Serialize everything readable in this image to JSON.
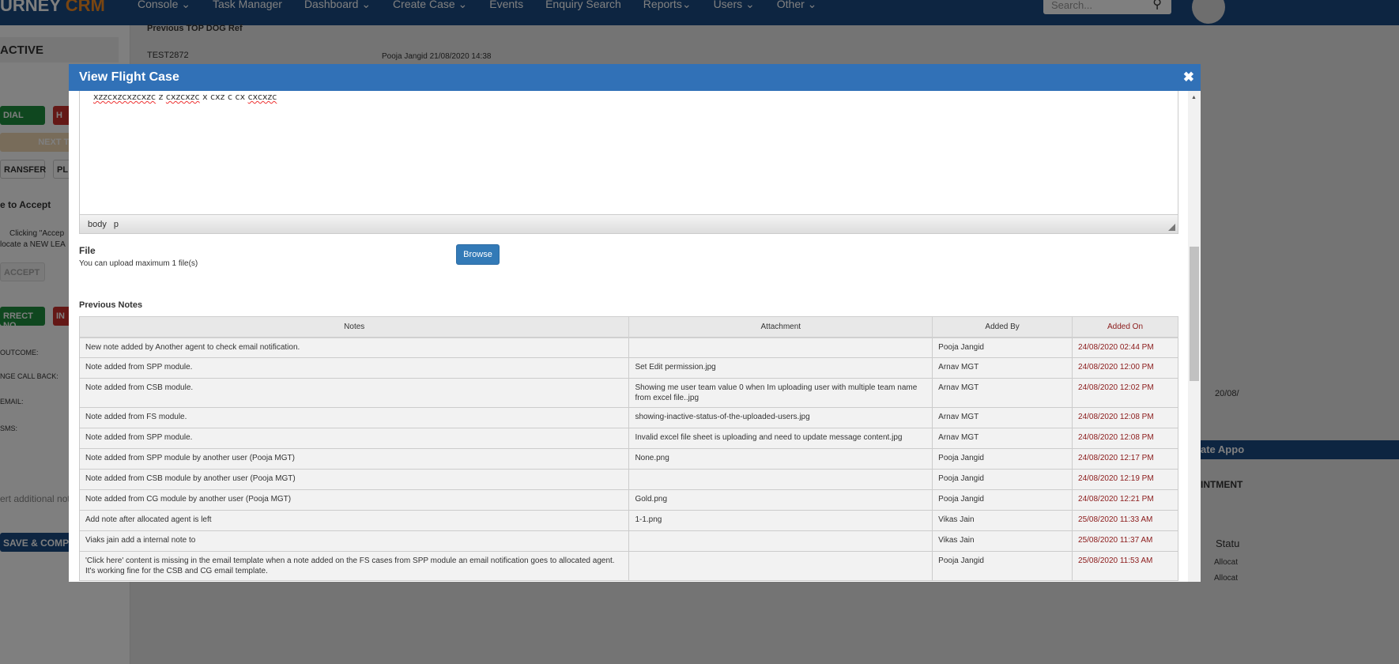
{
  "app": {
    "logo_main": "URNEY",
    "logo_accent": "CRM"
  },
  "nav": [
    "Console ⌄",
    "Task Manager",
    "Dashboard ⌄",
    "Create Case ⌄",
    "Events",
    "Enquiry Search",
    "Reports⌄",
    "Users ⌄",
    "Other ⌄"
  ],
  "search": {
    "placeholder": "Search..."
  },
  "left": {
    "status": "ACTIVE",
    "dial": "DIAL",
    "hangup": "H",
    "next_task": "NEXT TAS",
    "transfer": "RANSFER",
    "place": "PL",
    "accept_title": "e to Accept",
    "accept_msg1": "Clicking \"Accep",
    "accept_msg2": "locate a NEW LEA",
    "accept": "ACCEPT",
    "correct": "RRECT NO",
    "incorrect": "IN",
    "outcome": "OUTCOME:",
    "callback": "NGE CALL BACK:",
    "email": "EMAIL:",
    "sms": "SMS:",
    "notes_ph": "ert additional not",
    "save": "SAVE & COMP"
  },
  "mid": {
    "prev_ref_label": "Previous TOP DOG Ref",
    "ref": "TEST2872",
    "ref_by": "Pooja Jangid 21/08/2020 14:38"
  },
  "right": {
    "date": "20/08/",
    "appt_btn": "ate Appo",
    "appt_title": "INTMENT",
    "status_col": "Statu",
    "allocated": "Allocat"
  },
  "modal": {
    "title": "View Flight Case",
    "editor_words": [
      "xzzcxzcxzcxzc",
      "z",
      "cxzcxzc",
      "x",
      "cxz",
      "c",
      "cx",
      "cxcxzc"
    ],
    "editor_path": "body p",
    "file_label": "File",
    "file_hint": "You can upload maximum 1 file(s)",
    "browse": "Browse",
    "prev_notes": "Previous Notes",
    "columns": [
      "Notes",
      "Attachment",
      "Added By",
      "Added On"
    ],
    "rows": [
      [
        "New note added by Another agent to check email notification.",
        "",
        "Pooja Jangid",
        "24/08/2020 02:44 PM"
      ],
      [
        "Note added from SPP module.",
        "Set Edit permission.jpg",
        "Arnav MGT",
        "24/08/2020 12:00 PM"
      ],
      [
        "Note added from CSB  module.",
        "Showing me user team value 0 when Im uploading user with multiple team name from excel file..jpg",
        "Arnav MGT",
        "24/08/2020 12:02 PM"
      ],
      [
        "Note added from FS module.",
        "showing-inactive-status-of-the-uploaded-users.jpg",
        "Arnav MGT",
        "24/08/2020 12:08 PM"
      ],
      [
        "Note added from SPP module.",
        "Invalid excel file sheet is uploading and need to update message content.jpg",
        "Arnav MGT",
        "24/08/2020 12:08 PM"
      ],
      [
        "Note added from SPP module by another user (Pooja MGT)",
        "None.png",
        "Pooja Jangid",
        "24/08/2020 12:17 PM"
      ],
      [
        "Note added from CSB module by another user (Pooja MGT)",
        "",
        "Pooja Jangid",
        "24/08/2020 12:19 PM"
      ],
      [
        "Note added from CG module by another user (Pooja MGT)",
        "Gold.png",
        "Pooja Jangid",
        "24/08/2020 12:21 PM"
      ],
      [
        "Add note after allocated agent is left",
        "1-1.png",
        "Vikas Jain",
        "25/08/2020 11:33 AM"
      ],
      [
        "Viaks jain add a internal note to",
        "",
        "Vikas Jain",
        "25/08/2020 11:37 AM"
      ],
      [
        "'Click here' content is missing in the email template when a note added on the FS cases from SPP module an email notification goes to allocated agent. It's working fine for the CSB and CG email template.",
        "",
        "Pooja Jangid",
        "25/08/2020 11:53 AM"
      ]
    ]
  }
}
